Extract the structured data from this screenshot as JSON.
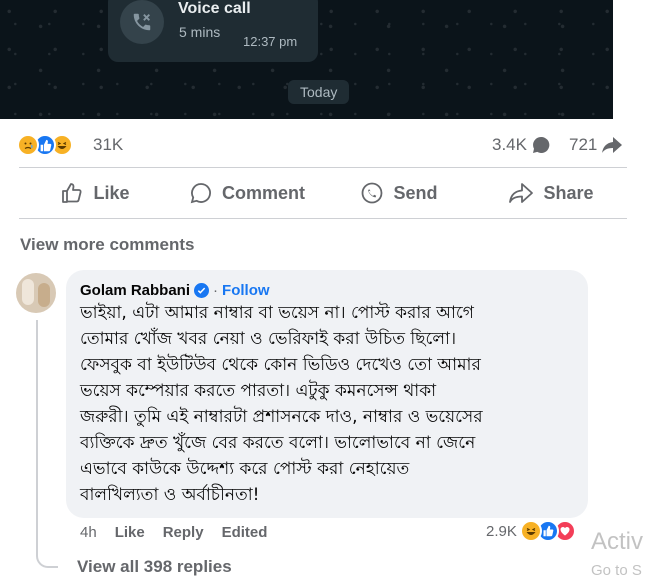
{
  "call": {
    "title": "Voice call",
    "duration": "5 mins",
    "time": "12:37 pm",
    "date_chip": "Today"
  },
  "post_stats": {
    "reaction_count": "31K",
    "comment_count": "3.4K",
    "share_count": "721",
    "reaction_icons": [
      "sad-emoji-icon",
      "like-icon",
      "haha-emoji-icon"
    ]
  },
  "actions": {
    "like": "Like",
    "comment": "Comment",
    "send": "Send",
    "share": "Share"
  },
  "view_more_comments": "View more comments",
  "comment": {
    "author": "Golam Rabbani",
    "separator": "·",
    "follow": "Follow",
    "text": "ভাইয়া, এটা আমার নাম্বার বা ভয়েস না। পোস্ট করার আগে\nতোমার খোঁজ খবর নেয়া ও ভেরিফাই করা উচিত ছিলো।\nফেসবুক বা ইউটিউব থেকে কোন ভিডিও দেখেও তো আমার\nভয়েস কম্পেয়ার করতে পারতা। এটুকু কমনসেন্স থাকা\nজরুরী। তুমি এই নাম্বারটা প্রশাসনকে দাও, নাম্বার ও ভয়েসের\nব্যক্তিকে দ্রুত খুঁজে বের করতে বলো। ভালোভাবে না জেনে\nএভাবে কাউকে উদ্দেশ্য করে পোস্ট করা নেহায়েত\nবালখিল্যতা ও অর্বাচীনতা!",
    "age": "4h",
    "like": "Like",
    "reply": "Reply",
    "edited": "Edited",
    "reaction_count": "2.9K",
    "reaction_icons": [
      "haha-emoji-icon",
      "like-icon",
      "love-icon"
    ],
    "view_replies": "View all 398 replies"
  },
  "watermark": {
    "line1": "Activ",
    "line2": "Go to S"
  },
  "colors": {
    "brand_blue": "#1877f2",
    "secondary_text": "#65676b",
    "bubble_bg": "#f0f2f5"
  }
}
